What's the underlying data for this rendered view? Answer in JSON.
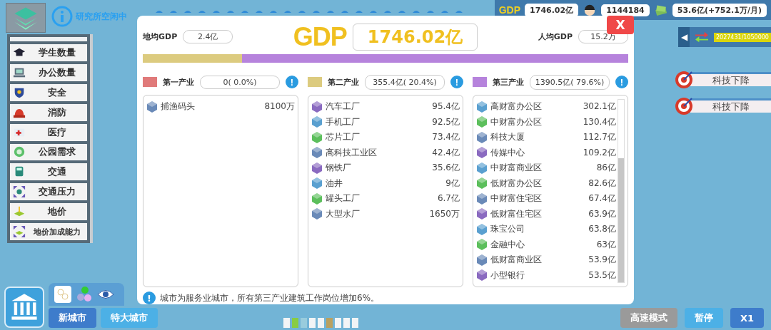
{
  "status": {
    "research": "研究所空闲中"
  },
  "sidebar": {
    "items": [
      {
        "label": "学生数量"
      },
      {
        "label": "办公数量"
      },
      {
        "label": "安全"
      },
      {
        "label": "消防"
      },
      {
        "label": "医疗"
      },
      {
        "label": "公园需求"
      },
      {
        "label": "交通"
      },
      {
        "label": "交通压力"
      },
      {
        "label": "地价"
      },
      {
        "label": "地价加成能力"
      }
    ]
  },
  "top_stats": {
    "gdp_logo": "GDP",
    "gdp": "1746.02亿",
    "population": "1144184",
    "money": "53.6亿(+752.1万/月)"
  },
  "side_panel": {
    "toggle": "◀",
    "progress_text": "2027431/1050000"
  },
  "alerts": [
    {
      "label": "科技下降"
    },
    {
      "label": "科技下降"
    }
  ],
  "modal": {
    "close": "X",
    "land_gdp": {
      "label": "地均GDP",
      "value": "2.4亿"
    },
    "title": "GDP",
    "total": "1746.02亿",
    "per_capita": {
      "label": "人均GDP",
      "value": "15.2万"
    },
    "sectors": [
      {
        "name": "第一产业",
        "value": "0( 0.0%)",
        "color": "#e07a7a",
        "info": "!",
        "items": [
          {
            "name": "捕渔码头",
            "value": "8100万"
          }
        ]
      },
      {
        "name": "第二产业",
        "value": "355.4亿( 20.4%)",
        "color": "#dccb7f",
        "info": "!",
        "items": [
          {
            "name": "汽车工厂",
            "value": "95.4亿"
          },
          {
            "name": "手机工厂",
            "value": "92.5亿"
          },
          {
            "name": "芯片工厂",
            "value": "73.4亿"
          },
          {
            "name": "高科技工业区",
            "value": "42.4亿"
          },
          {
            "name": "钢铁厂",
            "value": "35.6亿"
          },
          {
            "name": "油井",
            "value": "9亿"
          },
          {
            "name": "罐头工厂",
            "value": "6.7亿"
          },
          {
            "name": "大型水厂",
            "value": "1650万"
          }
        ]
      },
      {
        "name": "第三产业",
        "value": "1390.5亿( 79.6%)",
        "color": "#b683dc",
        "info": "!",
        "items": [
          {
            "name": "高财富办公区",
            "value": "302.1亿"
          },
          {
            "name": "中财富办公区",
            "value": "130.4亿"
          },
          {
            "name": "科技大厦",
            "value": "112.7亿"
          },
          {
            "name": "传媒中心",
            "value": "109.2亿"
          },
          {
            "name": "中财富商业区",
            "value": "86亿"
          },
          {
            "name": "低财富办公区",
            "value": "82.6亿"
          },
          {
            "name": "中财富住宅区",
            "value": "67.4亿"
          },
          {
            "name": "低财富住宅区",
            "value": "63.9亿"
          },
          {
            "name": "珠宝公司",
            "value": "63.8亿"
          },
          {
            "name": "金融中心",
            "value": "63亿"
          },
          {
            "name": "低财富商业区",
            "value": "53.9亿"
          },
          {
            "name": "小型银行",
            "value": "53.5亿"
          }
        ]
      }
    ],
    "share_bar": {
      "segments": [
        {
          "level": 0.204,
          "color": "#dccb7f"
        },
        {
          "level": 0.796,
          "color": "#b683dc"
        }
      ]
    },
    "note": {
      "icon": "!",
      "text": "城市为服务业城市，所有第三产业建筑工作岗位增加6%。"
    }
  },
  "bottom_bar": {
    "left_buttons": [
      {
        "label": "新城市",
        "kind": "primary"
      },
      {
        "label": "特大城市",
        "kind": "light"
      }
    ],
    "right_buttons": [
      {
        "label": "高速模式",
        "kind": "grey"
      },
      {
        "label": "暂停",
        "kind": "light"
      },
      {
        "label": "X1",
        "kind": "primary"
      }
    ]
  }
}
